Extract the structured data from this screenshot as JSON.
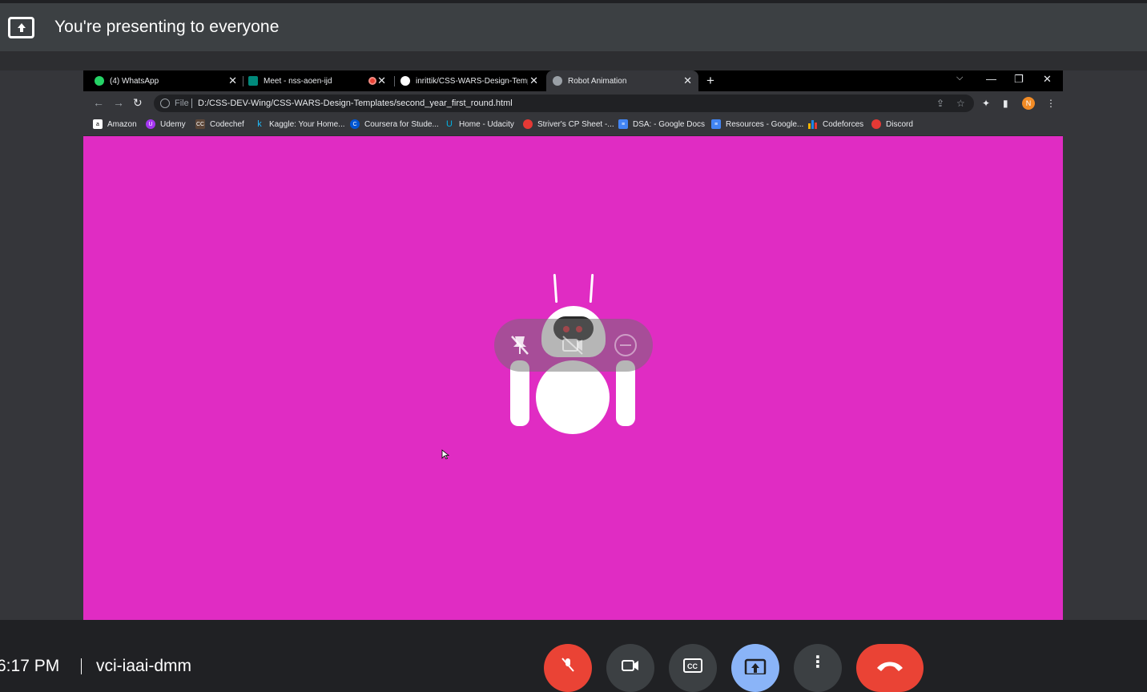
{
  "presenting": {
    "text": "You're presenting to everyone"
  },
  "browser": {
    "tabs": [
      {
        "label": "(4) WhatsApp",
        "color": "#25d366"
      },
      {
        "label": "Meet - nss-aoen-ijd",
        "color": "#00897b"
      },
      {
        "label": "inrittik/CSS-WARS-Design-Templ",
        "color": "#ffffff"
      },
      {
        "label": "Robot Animation",
        "color": "#9aa0a6"
      }
    ],
    "address": {
      "file_label": "File",
      "url": "D:/CSS-DEV-Wing/CSS-WARS-Design-Templates/second_year_first_round.html"
    },
    "profile_initial": "N",
    "bookmarks": [
      {
        "label": "Amazon",
        "color": "#ffffff"
      },
      {
        "label": "Udemy",
        "color": "#a435f0"
      },
      {
        "label": "Codechef",
        "color": "#5b4638"
      },
      {
        "label": "Kaggle: Your Home...",
        "color": "#20beff"
      },
      {
        "label": "Coursera for Stude...",
        "color": "#0056d2"
      },
      {
        "label": "Home - Udacity",
        "color": "#02b3e4"
      },
      {
        "label": "Striver's CP Sheet -...",
        "color": "#e53935"
      },
      {
        "label": "DSA: - Google Docs",
        "color": "#4285f4"
      },
      {
        "label": "Resources - Google...",
        "color": "#4285f4"
      },
      {
        "label": "Codeforces",
        "color": "#f4b400"
      },
      {
        "label": "Discord",
        "color": "#e53935"
      }
    ]
  },
  "page_bg": "#e02cc3",
  "meeting": {
    "time": "6:17 PM",
    "code": "vci-iaai-dmm"
  },
  "controls": {
    "mic_color": "#ea4335",
    "present_color": "#8ab4f8",
    "hangup_color": "#ea4335"
  }
}
